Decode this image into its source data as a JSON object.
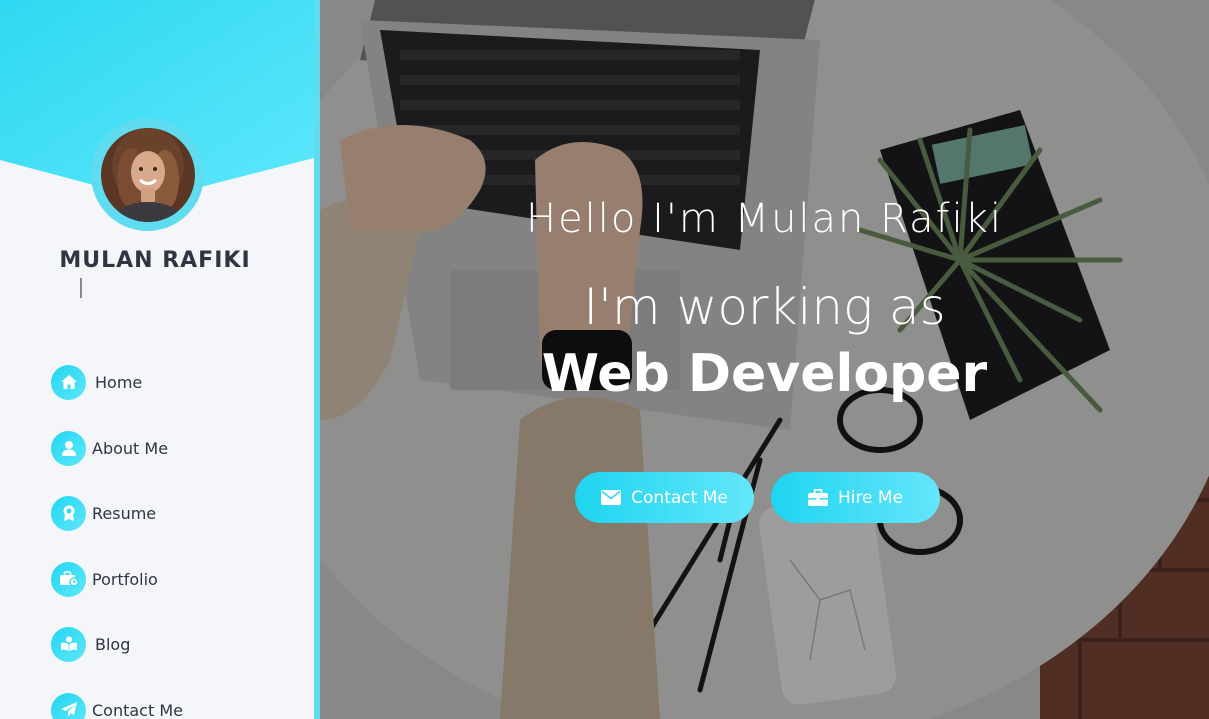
{
  "profile": {
    "name": "MULAN RAFIKI",
    "typed_text": "",
    "accent_color": "#22d6f0",
    "avatar_icon": "profile-photo"
  },
  "nav": {
    "items": [
      {
        "label": "Home",
        "icon": "home-icon"
      },
      {
        "label": "About Me",
        "icon": "user-icon"
      },
      {
        "label": "Resume",
        "icon": "award-icon"
      },
      {
        "label": "Portfolio",
        "icon": "briefcase-icon"
      },
      {
        "label": "Blog",
        "icon": "book-icon"
      },
      {
        "label": "Contact Me",
        "icon": "paper-plane-icon"
      }
    ]
  },
  "hero": {
    "greeting": "Hello I'm Mulan Rafiki",
    "working_as": "I'm working as",
    "role": "Web Developer",
    "contact_button": "Contact Me",
    "hire_button": "Hire Me"
  }
}
